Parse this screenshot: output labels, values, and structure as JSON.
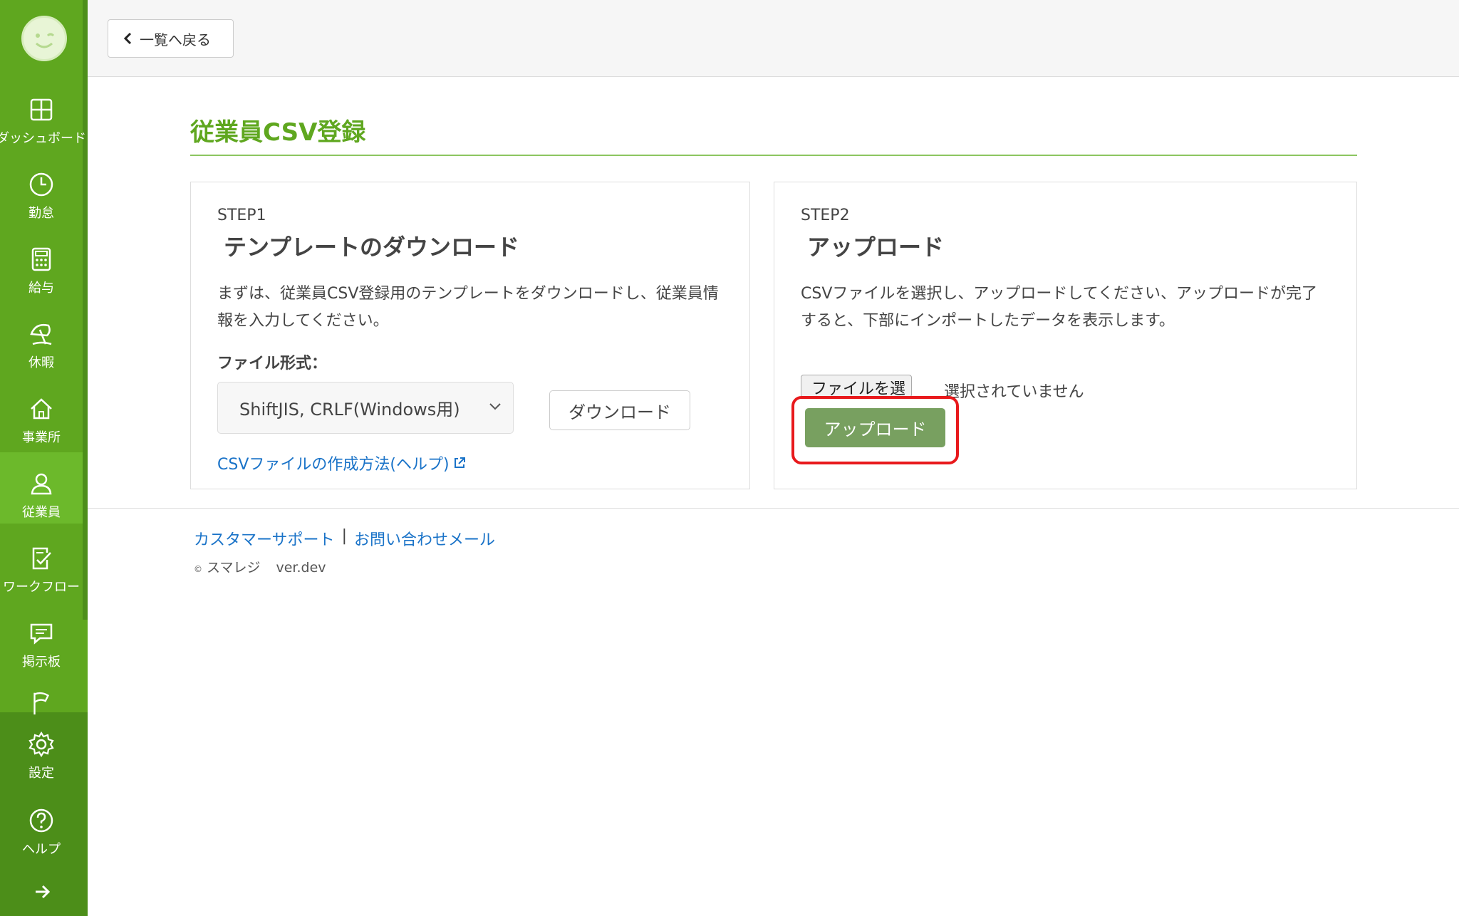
{
  "sidebar": {
    "items": [
      {
        "label": "ダッシュボード",
        "icon": "dashboard-icon"
      },
      {
        "label": "勤怠",
        "icon": "clock-icon"
      },
      {
        "label": "給与",
        "icon": "calculator-icon"
      },
      {
        "label": "休暇",
        "icon": "beach-umbrella-icon"
      },
      {
        "label": "事業所",
        "icon": "home-icon"
      },
      {
        "label": "従業員",
        "icon": "person-icon",
        "active": true
      },
      {
        "label": "ワークフロー",
        "icon": "checklist-icon"
      },
      {
        "label": "掲示板",
        "icon": "message-icon"
      },
      {
        "label": "",
        "icon": "flag-icon"
      },
      {
        "label": "設定",
        "icon": "gear-icon"
      },
      {
        "label": "ヘルプ",
        "icon": "help-circle-icon"
      }
    ]
  },
  "topbar": {
    "back_label": "一覧へ戻る"
  },
  "page": {
    "title": "従業員CSV登録"
  },
  "step1": {
    "step": "STEP1",
    "title": "テンプレートのダウンロード",
    "description": "まずは、従業員CSV登録用のテンプレートをダウンロードし、従業員情報を入力してください。",
    "format_label": "ファイル形式：",
    "format_selected": "ShiftJIS, CRLF(Windows用)",
    "download_label": "ダウンロード",
    "help_link": "CSVファイルの作成方法(ヘルプ)"
  },
  "step2": {
    "step": "STEP2",
    "title": "アップロード",
    "description": "CSVファイルを選択し、アップロードしてください、アップロードが完了すると、下部にインポートしたデータを表示します。",
    "file_button": "ファイルを選択",
    "file_status": "選択されていません",
    "upload_label": "アップロード"
  },
  "footer": {
    "support": "カスタマーサポート",
    "separator": "|",
    "contact": "お問い合わせメール",
    "copyright_mark": "©",
    "brand": "スマレジ",
    "version": "ver.dev"
  },
  "colors": {
    "sidebar": "#5fa71f",
    "title": "#5fa71f",
    "link": "#1a73c8",
    "upload_button": "#78a060",
    "highlight": "#e8191c"
  }
}
